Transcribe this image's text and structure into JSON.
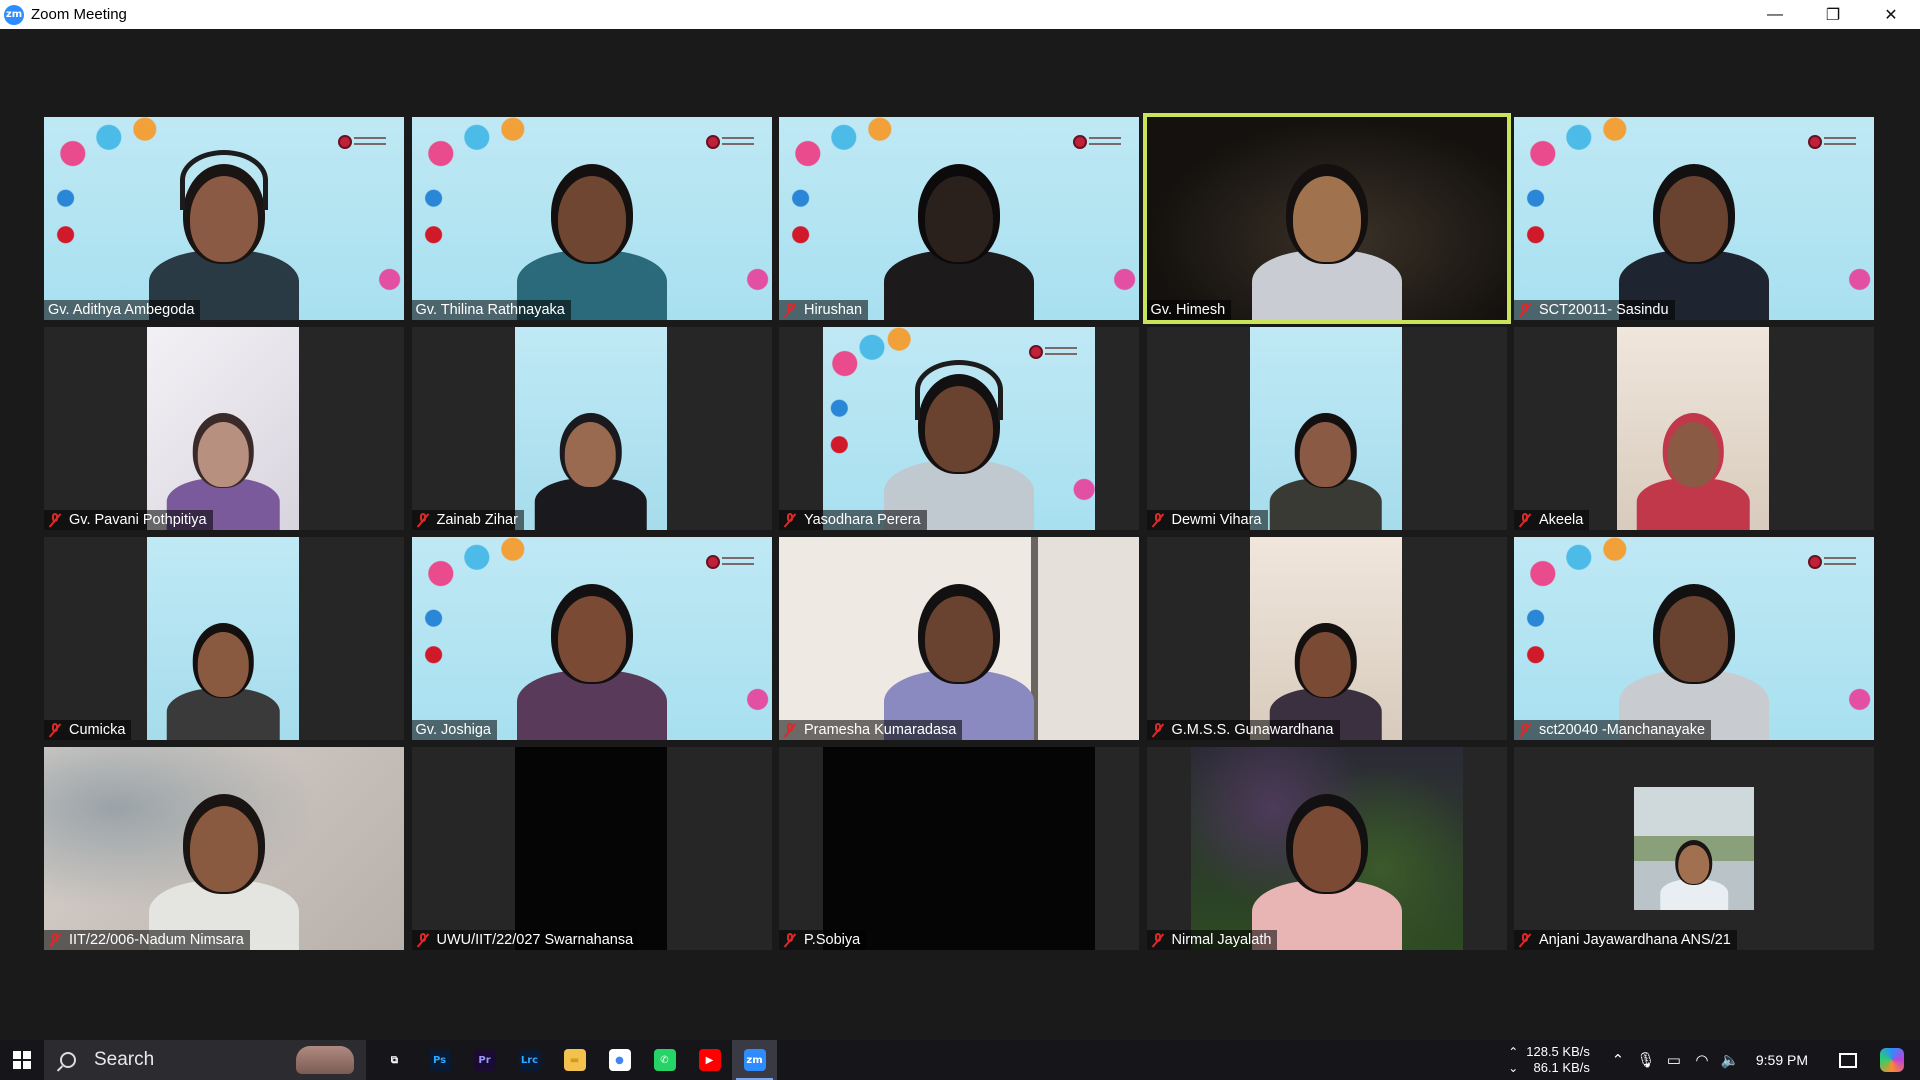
{
  "window": {
    "title": "Zoom Meeting",
    "app_icon": "zm",
    "minimize": "—",
    "restore": "❐",
    "close": "✕"
  },
  "participants": [
    {
      "name": "Gv. Adithya Ambegoda",
      "muted": false,
      "bg": "bg-easter",
      "layout": "full",
      "skin": "#8a5a44",
      "shirt": "#2a3a44",
      "hair": "#1a1412",
      "headset": true,
      "logo": true
    },
    {
      "name": "Gv. Thilina Rathnayaka",
      "muted": false,
      "bg": "bg-easter",
      "layout": "full",
      "skin": "#6e4632",
      "shirt": "#2a6a7a",
      "hair": "#141010",
      "headset": false,
      "logo": true
    },
    {
      "name": "Hirushan",
      "muted": true,
      "bg": "bg-easter",
      "layout": "full",
      "skin": "#2a201c",
      "shirt": "#1c1a1a",
      "hair": "#0c0a0a",
      "headset": false,
      "logo": true
    },
    {
      "name": "Gv. Himesh",
      "muted": false,
      "active": true,
      "bg": "bg-dark",
      "layout": "full",
      "skin": "#a0724e",
      "shirt": "#c9ccd2",
      "hair": "#141010",
      "headset": false,
      "logo": false
    },
    {
      "name": "SCT20011- Sasindu",
      "muted": true,
      "bg": "bg-easter",
      "layout": "full",
      "skin": "#6a4230",
      "shirt": "#1e2430",
      "hair": "#121010",
      "headset": false,
      "logo": true
    },
    {
      "name": "Gv. Pavani Pothpitiya",
      "muted": true,
      "bg": "bg-white",
      "layout": "mid",
      "skin": "#b89080",
      "shirt": "#7a5a9a",
      "hair": "#3a2a2a",
      "headset": false,
      "logo": false
    },
    {
      "name": "Zainab Zihar",
      "muted": true,
      "bg": "bg-cyan",
      "layout": "mid",
      "skin": "#9a6a50",
      "shirt": "#1a1a1e",
      "hair": "#1a1a1e",
      "headset": false,
      "logo": false
    },
    {
      "name": "Yasodhara Perera",
      "muted": true,
      "bg": "bg-easter",
      "layout": "wide",
      "skin": "#6a4230",
      "shirt": "#c0c8d0",
      "hair": "#121010",
      "headset": true,
      "logo": true
    },
    {
      "name": "Dewmi Vihara",
      "muted": true,
      "bg": "bg-cyan",
      "layout": "mid",
      "skin": "#8a5a44",
      "shirt": "#3a3a34",
      "hair": "#141010",
      "headset": false,
      "logo": false
    },
    {
      "name": "Akeela",
      "muted": true,
      "bg": "bg-wall",
      "layout": "mid",
      "skin": "#8a5a44",
      "shirt": "#c0384a",
      "hair": "#c0384a",
      "headset": false,
      "logo": false
    },
    {
      "name": "Cumicka",
      "muted": true,
      "bg": "bg-cyan",
      "layout": "mid",
      "skin": "#8a5a40",
      "shirt": "#3a3a3a",
      "hair": "#141010",
      "headset": false,
      "logo": false
    },
    {
      "name": "Gv. Joshiga",
      "muted": false,
      "bg": "bg-easter",
      "layout": "full",
      "skin": "#7a4a34",
      "shirt": "#5a3a5a",
      "hair": "#121010",
      "headset": false,
      "logo": true
    },
    {
      "name": "Pramesha Kumaradasa",
      "muted": true,
      "bg": "bg-room",
      "layout": "full",
      "skin": "#6a4230",
      "shirt": "#8a8ac0",
      "hair": "#121010",
      "headset": false,
      "logo": false
    },
    {
      "name": "G.M.S.S. Gunawardhana",
      "muted": true,
      "bg": "bg-wall",
      "layout": "mid",
      "skin": "#7a4a34",
      "shirt": "#3a3040",
      "hair": "#141010",
      "headset": false,
      "logo": false
    },
    {
      "name": "sct20040 -Manchanayake",
      "muted": true,
      "bg": "bg-easter",
      "layout": "full",
      "skin": "#6a4230",
      "shirt": "#c8ccd0",
      "hair": "#121010",
      "headset": false,
      "logo": true
    },
    {
      "name": "IIT/22/006-Nadum Nimsara",
      "muted": true,
      "bg": "bg-blur",
      "layout": "full",
      "skin": "#8a5a40",
      "shirt": "#e4e4e0",
      "hair": "#1a1412",
      "headset": false,
      "logo": false
    },
    {
      "name": "UWU/IIT/22/027 Swarnahansa",
      "muted": true,
      "bg": "bg-black",
      "layout": "mid",
      "skin": "",
      "shirt": "",
      "hair": "",
      "headset": false,
      "logo": false
    },
    {
      "name": "P.Sobiya",
      "muted": true,
      "bg": "bg-black",
      "layout": "wide",
      "skin": "",
      "shirt": "",
      "hair": "",
      "headset": false,
      "logo": false
    },
    {
      "name": "Nirmal Jayalath",
      "muted": true,
      "bg": "bg-garden",
      "layout": "wide",
      "skin": "#7a4a34",
      "shirt": "#e8b4b4",
      "hair": "#121010",
      "headset": false,
      "logo": false
    },
    {
      "name": "Anjani Jayawardhana ANS/21",
      "muted": true,
      "bg": "bg-outdoor",
      "layout": "small",
      "skin": "#a07050",
      "shirt": "#e8eef2",
      "hair": "#1a1412",
      "headset": false,
      "logo": false
    }
  ],
  "taskbar": {
    "search_placeholder": "Search",
    "apps": [
      {
        "name": "task-view",
        "label": "⧉",
        "bg": "transparent",
        "color": "#ffffff"
      },
      {
        "name": "photoshop",
        "label": "Ps",
        "bg": "#0b1a33",
        "color": "#31a8ff"
      },
      {
        "name": "premiere",
        "label": "Pr",
        "bg": "#1a0b33",
        "color": "#9999ff"
      },
      {
        "name": "lightroom-classic",
        "label": "Lrc",
        "bg": "#0b1a33",
        "color": "#31a8ff"
      },
      {
        "name": "file-explorer",
        "label": "▬",
        "bg": "#f2c14e",
        "color": "#d49a1a"
      },
      {
        "name": "chrome",
        "label": "●",
        "bg": "#ffffff",
        "color": "#4285f4"
      },
      {
        "name": "whatsapp",
        "label": "✆",
        "bg": "#25d366",
        "color": "#ffffff"
      },
      {
        "name": "youtube",
        "label": "▶",
        "bg": "#ff0000",
        "color": "#ffffff"
      },
      {
        "name": "zoom",
        "label": "zm",
        "bg": "#2d8cff",
        "color": "#ffffff",
        "active": true
      }
    ],
    "net_up": "128.5 KB/s",
    "net_down": "86.1 KB/s",
    "clock": "9:59 PM"
  }
}
